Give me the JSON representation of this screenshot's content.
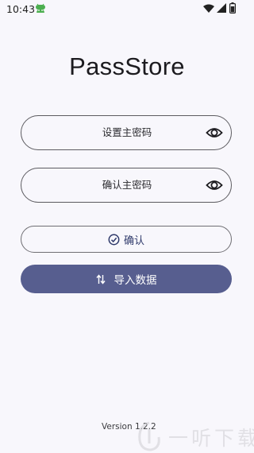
{
  "status_bar": {
    "time": "10:43",
    "notification_icon": "android-face-icon",
    "wifi_icon": "wifi-icon",
    "signal_icon": "signal-icon",
    "battery_icon": "battery-icon"
  },
  "app": {
    "title": "PassStore"
  },
  "form": {
    "master_password_label": "设置主密码",
    "confirm_password_label": "确认主密码",
    "visibility_icon": "eye-icon"
  },
  "actions": {
    "confirm_label": "确认",
    "confirm_icon": "check-circle-icon",
    "import_label": "导入数据",
    "import_icon": "swap-vertical-icon"
  },
  "footer": {
    "version": "Version 1.2.2"
  },
  "watermark": {
    "text": "一听下载"
  },
  "colors": {
    "background": "#f8f7fc",
    "primary": "#575e8f",
    "outline": "#5c5b60",
    "status_icon_green": "#4caf50"
  }
}
